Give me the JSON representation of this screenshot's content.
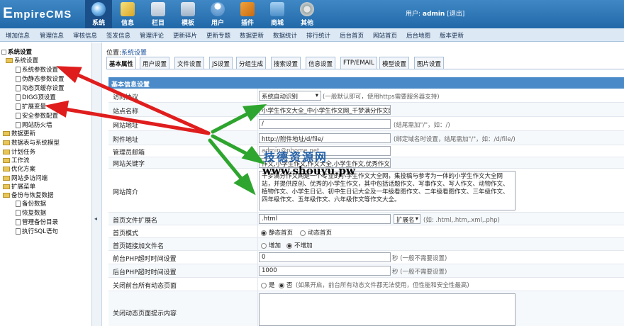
{
  "logo": {
    "text_big": "E",
    "text_rest": "mpireCMS"
  },
  "toolbar": [
    {
      "label": "系统",
      "icon": "globe-icon",
      "active": true
    },
    {
      "label": "信息",
      "icon": "pencil-icon"
    },
    {
      "label": "栏目",
      "icon": "folder-icon"
    },
    {
      "label": "模板",
      "icon": "template-icon"
    },
    {
      "label": "用户",
      "icon": "user-icon"
    },
    {
      "label": "插件",
      "icon": "plugin-icon"
    },
    {
      "label": "商城",
      "icon": "shop-icon"
    },
    {
      "label": "其他",
      "icon": "gear-icon"
    }
  ],
  "user": {
    "prefix": "用户:",
    "name": "admin",
    "logout": "[退出]"
  },
  "menu": [
    "增加信息",
    "管理信息",
    "审核信息",
    "签发信息",
    "管理评论",
    "更新碎片",
    "更新专题",
    "数据更新",
    "数据统计",
    "排行统计",
    "后台首页",
    "网站首页",
    "后台地图",
    "版本更新"
  ],
  "tree": [
    {
      "label": "系统设置",
      "type": "root"
    },
    {
      "label": "系统设置",
      "type": "folder"
    },
    {
      "label": "系统参数设置",
      "type": "page"
    },
    {
      "label": "伪静态参数设置",
      "type": "page"
    },
    {
      "label": "动态页缓存设置",
      "type": "page"
    },
    {
      "label": "DIGG顶设置",
      "type": "page"
    },
    {
      "label": "扩展变量",
      "type": "page"
    },
    {
      "label": "安全参数配置",
      "type": "page"
    },
    {
      "label": "网站防火墙",
      "type": "page"
    },
    {
      "label": "数据更新",
      "type": "folder"
    },
    {
      "label": "数据表与系统模型",
      "type": "folder"
    },
    {
      "label": "计划任务",
      "type": "folder"
    },
    {
      "label": "工作流",
      "type": "folder"
    },
    {
      "label": "优化方案",
      "type": "folder"
    },
    {
      "label": "网站多访问端",
      "type": "folder"
    },
    {
      "label": "扩展菜单",
      "type": "folder"
    },
    {
      "label": "备份与恢复数据",
      "type": "folder"
    },
    {
      "label": "备份数据",
      "type": "page"
    },
    {
      "label": "恢复数据",
      "type": "page"
    },
    {
      "label": "管理备份目录",
      "type": "page"
    },
    {
      "label": "执行SQL语句",
      "type": "page"
    }
  ],
  "breadcrumb": {
    "prefix": "位置:",
    "link": "系统设置"
  },
  "tabs": [
    "基本属性",
    "用户设置",
    "文件设置",
    "JS设置",
    "分组生成",
    "搜索设置",
    "信息设置",
    "FTP/EMAIL",
    "模型设置",
    "图片设置"
  ],
  "section_title": "基本信息设置",
  "form": {
    "protocol": {
      "label": "访问协议",
      "value": "系统自动识别",
      "hint": "(一般默认即可，使用https需要服务器支持)"
    },
    "site_name": {
      "label": "站点名称",
      "value": "小学生作文大全_中小学生作文网_千梦满分作文网"
    },
    "site_url": {
      "label": "网站地址",
      "value": "/",
      "hint": "(结尾需加\"/\"，如：/)"
    },
    "attach_url": {
      "label": "附件地址",
      "value": "http://附件地址/d/file/",
      "hint": "(绑定域名时设置，结尾需加\"/\"，如：/d/file/)"
    },
    "admin_email": {
      "label": "管理员邮箱",
      "value": "admin@phome.net"
    },
    "keywords": {
      "label": "网站关键字",
      "value": "作文,小学生作文,作文大全,小学生作文,优秀作文"
    },
    "intro": {
      "label": "网站简介",
      "value": "千梦满分作文网是一个专业的小学生作文大全网，集投稿与参考为一体的小学生作文大全网站，并提供原创、优秀的小学生作文，其中包括话题作文、写事作文、写人作文、动物作文、植物作文、小学生日记、初中生日记大全及一年级看图作文、二年级看图作文、三年级作文、四年级作文、五年级作文、六年级作文等作文大全。"
    },
    "index_ext": {
      "label": "首页文件扩展名",
      "value": ".html",
      "select": "扩展名",
      "hint": "(如: .html,.htm,.xml,.php)"
    },
    "index_mode": {
      "label": "首页模式",
      "opt1": "静态首页",
      "opt2": "动态首页",
      "selected": 1
    },
    "index_link": {
      "label": "首页链接加文件名",
      "opt1": "增加",
      "opt2": "不增加",
      "selected": 2
    },
    "front_timeout": {
      "label": "前台PHP超时时间设置",
      "value": "0",
      "hint": "秒 (一般不需要设置)"
    },
    "back_timeout": {
      "label": "后台PHP超时时间设置",
      "value": "1000",
      "hint": "秒 (一般不需要设置)"
    },
    "close_dynamic": {
      "label": "关闭前台所有动态页面",
      "opt1": "是",
      "opt2": "否",
      "hint": "(如果开启，前台所有动态文件都无法使用，但性能和安全性最高)",
      "selected": 2
    },
    "close_tip": {
      "label": "关闭动态页面提示内容",
      "value": ""
    }
  },
  "watermark": {
    "line1": "技德资源网",
    "line2": "www.shouyu.pw"
  },
  "colors": {
    "header": "#2f7bbf",
    "section": "#4a8ac8",
    "arrow_red": "#e01d1d",
    "arrow_green": "#2ea52e"
  }
}
